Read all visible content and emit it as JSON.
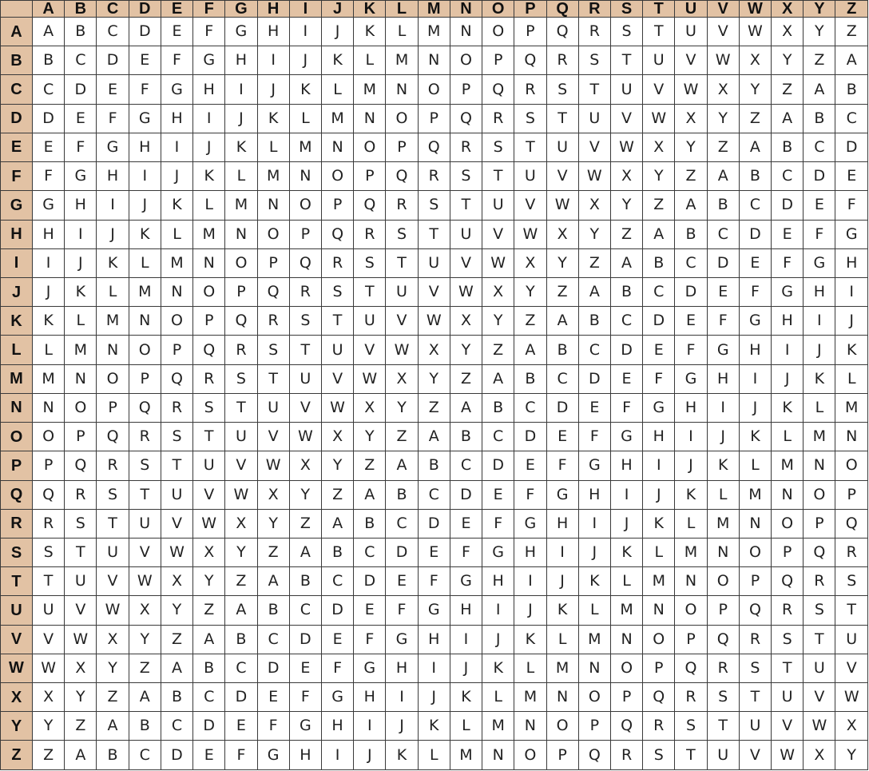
{
  "table": {
    "corner": "",
    "header_color": "#e2c2a4",
    "letters": [
      "A",
      "B",
      "C",
      "D",
      "E",
      "F",
      "G",
      "H",
      "I",
      "J",
      "K",
      "L",
      "M",
      "N",
      "O",
      "P",
      "Q",
      "R",
      "S",
      "T",
      "U",
      "V",
      "W",
      "X",
      "Y",
      "Z"
    ],
    "rows": [
      "ABCDEFGHIJKLMNOPQRSTUVWXYZ",
      "BCDEFGHIJKLMNOPQRSTUVWXYZA",
      "CDEFGHIJKLMNOPQRSTUVWXYZAB",
      "DEFGHIJKLMNOPQRSTUVWXYZABC",
      "EFGHIJKLMNOPQRSTUVWXYZABCD",
      "FGHIJKLMNOPQRSTUVWXYZABCDE",
      "GHIJKLMNOPQRSTUVWXYZABCDEF",
      "HIJKLMNOPQRSTUVWXYZABCDEFG",
      "IJKLMNOPQRSTUVWXYZABCDEFGH",
      "JKLMNOPQRSTUVWXYZABCDEFGHI",
      "KLMNOPQRSTUVWXYZABCDEFGHIJ",
      "LMNOPQRSTUVWXYZABCDEFGHIJK",
      "MNOPQRSTUVWXYZABCDEFGHIJKL",
      "NOPQRSTUVWXYZABCDEFGHIJKLM",
      "OPQRSTUVWXYZABCDEFGHIJKLMN",
      "PQRSTUVWXYZABCDEFGHIJKLMNO",
      "QRSTUVWXYZABCDEFGHIJKLMNOP",
      "RSTUVWXYZABCDEFGHIJKLMNOPQ",
      "STUVWXYZABCDEFGHIJKLMNOPQR",
      "TUVWXYZABCDEFGHIJKLMNOPQRS",
      "UVWXYZABCDEFGHIJKLMNOPQRST",
      "VWXYZABCDEFGHIJKLMNOPQRSTU",
      "WXYZABCDEFGHIJKLMNOPQRSTUV",
      "XYZABCDEFGHIJKLMNOPQRSTUVW",
      "YZABCDEFGHIJKLMNOPQRSTUVWX",
      "ZABCDEFGHIJKLMNOPQRSTUVWXY"
    ]
  }
}
